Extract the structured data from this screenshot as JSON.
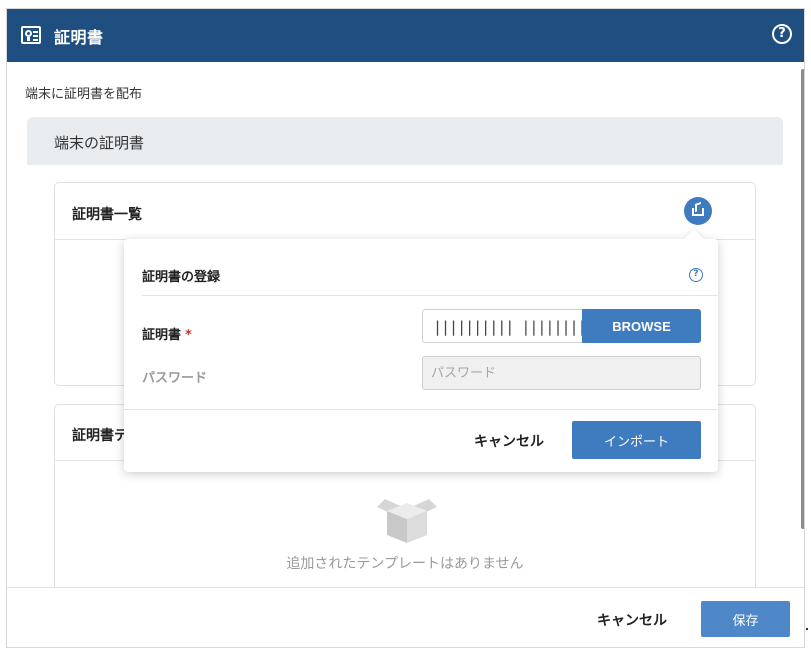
{
  "header": {
    "title": "証明書",
    "help_icon": "help-circle-icon",
    "background": "#1f4e80"
  },
  "subtitle": "端末に証明書を配布",
  "section": {
    "title": "端末の証明書"
  },
  "certificate_list": {
    "title": "証明書一覧",
    "import_icon": "import-icon"
  },
  "template_list": {
    "title": "証明書テ",
    "empty_icon": "empty-box-icon",
    "empty_text": "追加されたテンプレートはありません"
  },
  "popup": {
    "title": "証明書の登録",
    "help_icon": "help-circle-icon",
    "certificate_label": "証明書",
    "required_mark": "*",
    "file_value": "|||||||||| ||||||||| ||||||",
    "browse_label": "BROWSE",
    "password_label": "パスワード",
    "password_placeholder": "パスワード",
    "cancel_label": "キャンセル",
    "import_label": "インポート"
  },
  "footer": {
    "cancel_label": "キャンセル",
    "save_label": "保存"
  },
  "colors": {
    "accent": "#3f7bbf",
    "header": "#1f4e80",
    "required": "#c0392b"
  }
}
